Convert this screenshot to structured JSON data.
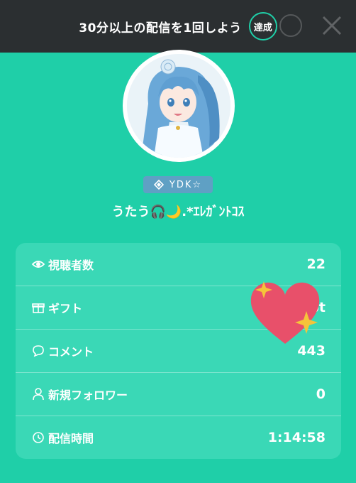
{
  "banner": {
    "mission_text": "30分以上の配信を1回しよう",
    "achieved_label": "達成"
  },
  "profile": {
    "rank_label": "YDK☆",
    "username": "うたう🎧🌙.*ｴﾚｶﾞﾝﾄｺｽ"
  },
  "stats": {
    "viewers": {
      "label": "視聴者数",
      "value": "22",
      "icon": "eye-icon"
    },
    "gifts": {
      "label": "ギフト",
      "value": "pt",
      "icon": "gift-icon"
    },
    "comments": {
      "label": "コメント",
      "value": "443",
      "icon": "comment-icon"
    },
    "new_followers": {
      "label": "新規フォロワー",
      "value": "0",
      "icon": "person-icon"
    },
    "stream_time": {
      "label": "配信時間",
      "value": "1:14:58",
      "icon": "clock-icon"
    }
  },
  "colors": {
    "background": "#1fcfa8",
    "card": "#3ad8b6",
    "banner": "#2b2f31",
    "rank_badge": "#5fa0c4",
    "heart": "#e8506a",
    "sparkle": "#f5c43a"
  }
}
